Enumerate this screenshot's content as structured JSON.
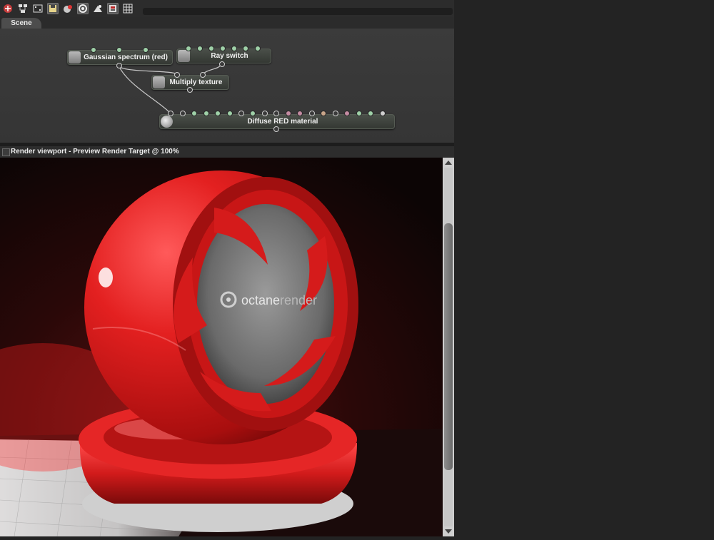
{
  "tabs": [
    {
      "label": "Scene"
    }
  ],
  "toolbar": {
    "icons": [
      "render-icon",
      "node-graph-icon",
      "camera-icon",
      "save-icon",
      "material-icon",
      "kernel-icon",
      "environment-icon",
      "settings-icon",
      "grid-icon"
    ]
  },
  "graph": {
    "nodes": [
      {
        "title": "Gaussian spectrum (red)"
      },
      {
        "title": "Ray switch"
      },
      {
        "title": "Multiply texture"
      },
      {
        "title": "Diffuse RED material"
      }
    ]
  },
  "viewport": {
    "title": "Render viewport - Preview Render Target @ 100%"
  },
  "render": {
    "logo_text_a": "octane",
    "logo_text_b": "render",
    "accent_color": "#d92020"
  }
}
